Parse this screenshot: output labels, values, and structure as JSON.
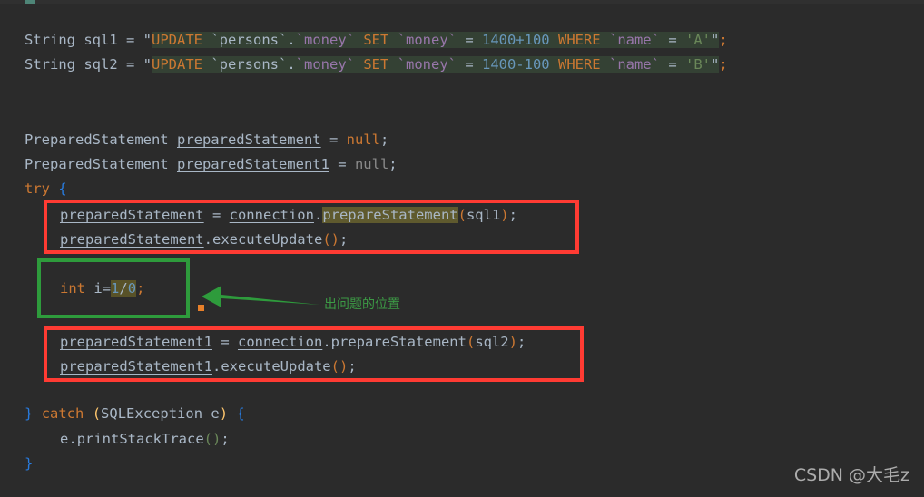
{
  "editor": {
    "theme_background": "#2b2b2b",
    "default_text_color": "#a9b7c6",
    "string_highlight_background": "#344134",
    "search_highlight_background": "#5f5a2e"
  },
  "code": {
    "lines": [
      {
        "id": "sql1",
        "parts": [
          {
            "text": "String ",
            "cls": "t-type"
          },
          {
            "text": "sql1",
            "cls": "t-var"
          },
          {
            "text": " = ",
            "cls": "t-op"
          },
          {
            "text": "\"",
            "cls": "t-quote"
          },
          {
            "text": "UPDATE ",
            "cls": "t-sqlkw sqlbg"
          },
          {
            "text": "`persons`",
            "cls": "t-sqlid sqlbg"
          },
          {
            "text": ".",
            "cls": "t-punc sqlbg"
          },
          {
            "text": "`money` ",
            "cls": "t-sqlcol sqlbg"
          },
          {
            "text": "SET ",
            "cls": "t-sqlkw sqlbg"
          },
          {
            "text": "`money`",
            "cls": "t-sqlcol sqlbg"
          },
          {
            "text": " = ",
            "cls": "t-op sqlbg"
          },
          {
            "text": "1400+100 ",
            "cls": "t-num sqlbg"
          },
          {
            "text": "WHERE ",
            "cls": "t-sqlkw sqlbg"
          },
          {
            "text": "`name`",
            "cls": "t-sqlcol sqlbg"
          },
          {
            "text": " = ",
            "cls": "t-op sqlbg"
          },
          {
            "text": "'A'",
            "cls": "t-str sqlbg"
          },
          {
            "text": "\"",
            "cls": "t-quote sqlbg"
          },
          {
            "text": ";",
            "cls": "t-kw"
          }
        ]
      },
      {
        "id": "sql2",
        "parts": [
          {
            "text": "String ",
            "cls": "t-type"
          },
          {
            "text": "sql2",
            "cls": "t-var"
          },
          {
            "text": " = ",
            "cls": "t-op"
          },
          {
            "text": "\"",
            "cls": "t-quote"
          },
          {
            "text": "UPDATE ",
            "cls": "t-sqlkw sqlbg"
          },
          {
            "text": "`persons`",
            "cls": "t-sqlid sqlbg"
          },
          {
            "text": ".",
            "cls": "t-punc sqlbg"
          },
          {
            "text": "`money` ",
            "cls": "t-sqlcol sqlbg"
          },
          {
            "text": "SET ",
            "cls": "t-sqlkw sqlbg"
          },
          {
            "text": "`money`",
            "cls": "t-sqlcol sqlbg"
          },
          {
            "text": " = ",
            "cls": "t-op sqlbg"
          },
          {
            "text": "1400-100 ",
            "cls": "t-num sqlbg"
          },
          {
            "text": "WHERE ",
            "cls": "t-sqlkw sqlbg"
          },
          {
            "text": "`name`",
            "cls": "t-sqlcol sqlbg"
          },
          {
            "text": " = ",
            "cls": "t-op sqlbg"
          },
          {
            "text": "'B'",
            "cls": "t-str sqlbg"
          },
          {
            "text": "\"",
            "cls": "t-quote sqlbg"
          },
          {
            "text": ";",
            "cls": "t-kw"
          }
        ]
      },
      {
        "id": "decl-ps",
        "parts": [
          {
            "text": "PreparedStatement ",
            "cls": "t-type"
          },
          {
            "text": "preparedStatement",
            "cls": "t-var u"
          },
          {
            "text": " = ",
            "cls": "t-op"
          },
          {
            "text": "null",
            "cls": "t-kw"
          },
          {
            "text": ";",
            "cls": "t-punc"
          }
        ]
      },
      {
        "id": "decl-ps1",
        "parts": [
          {
            "text": "PreparedStatement ",
            "cls": "t-type"
          },
          {
            "text": "preparedStatement1",
            "cls": "t-var u"
          },
          {
            "text": " = ",
            "cls": "t-op"
          },
          {
            "text": "null",
            "cls": "t-null"
          },
          {
            "text": ";",
            "cls": "t-punc"
          }
        ]
      },
      {
        "id": "try",
        "parts": [
          {
            "text": "try",
            "cls": "t-kw"
          },
          {
            "text": " ",
            "cls": "t-op"
          },
          {
            "text": "{",
            "cls": "t-brace"
          }
        ]
      },
      {
        "id": "assign-ps",
        "parts": [
          {
            "text": "preparedStatement",
            "cls": "t-var u"
          },
          {
            "text": " = ",
            "cls": "t-op"
          },
          {
            "text": "connection",
            "cls": "t-var u"
          },
          {
            "text": ".",
            "cls": "t-punc"
          },
          {
            "text": "prepareStatement",
            "cls": "t-method hl-olive"
          },
          {
            "text": "(",
            "cls": "t-paren"
          },
          {
            "text": "sql1",
            "cls": "t-var"
          },
          {
            "text": ")",
            "cls": "t-paren"
          },
          {
            "text": ";",
            "cls": "t-punc"
          }
        ]
      },
      {
        "id": "exec-ps",
        "parts": [
          {
            "text": "preparedStatement",
            "cls": "t-var u"
          },
          {
            "text": ".",
            "cls": "t-punc"
          },
          {
            "text": "executeUpdate",
            "cls": "t-method"
          },
          {
            "text": "()",
            "cls": "t-paren"
          },
          {
            "text": ";",
            "cls": "t-punc"
          }
        ]
      },
      {
        "id": "div-zero",
        "parts": [
          {
            "text": "int",
            "cls": "t-kw"
          },
          {
            "text": " ",
            "cls": "t-op"
          },
          {
            "text": "i",
            "cls": "t-var"
          },
          {
            "text": "=",
            "cls": "t-op"
          },
          {
            "text": "1",
            "cls": "t-num hl-olive2"
          },
          {
            "text": "/",
            "cls": "t-op hl-olive2"
          },
          {
            "text": "0",
            "cls": "t-num hl-olive2"
          },
          {
            "text": ";",
            "cls": "t-kw"
          }
        ]
      },
      {
        "id": "assign-ps1",
        "parts": [
          {
            "text": "preparedStatement1",
            "cls": "t-var u"
          },
          {
            "text": " = ",
            "cls": "t-op"
          },
          {
            "text": "connection",
            "cls": "t-var u"
          },
          {
            "text": ".",
            "cls": "t-punc"
          },
          {
            "text": "prepareStatement",
            "cls": "t-method"
          },
          {
            "text": "(",
            "cls": "t-paren"
          },
          {
            "text": "sql2",
            "cls": "t-var"
          },
          {
            "text": ")",
            "cls": "t-paren"
          },
          {
            "text": ";",
            "cls": "t-punc"
          }
        ]
      },
      {
        "id": "exec-ps1",
        "parts": [
          {
            "text": "preparedStatement1",
            "cls": "t-var u"
          },
          {
            "text": ".",
            "cls": "t-punc"
          },
          {
            "text": "executeUpdate",
            "cls": "t-method"
          },
          {
            "text": "()",
            "cls": "t-paren"
          },
          {
            "text": ";",
            "cls": "t-punc"
          }
        ]
      },
      {
        "id": "catch",
        "parts": [
          {
            "text": "}",
            "cls": "t-brace"
          },
          {
            "text": " ",
            "cls": "t-op"
          },
          {
            "text": "catch",
            "cls": "t-kw"
          },
          {
            "text": " ",
            "cls": "t-op"
          },
          {
            "text": "(",
            "cls": "t-class"
          },
          {
            "text": "SQLException",
            "cls": "t-type"
          },
          {
            "text": " e",
            "cls": "t-var"
          },
          {
            "text": ")",
            "cls": "t-class"
          },
          {
            "text": " ",
            "cls": "t-op"
          },
          {
            "text": "{",
            "cls": "t-brace"
          }
        ]
      },
      {
        "id": "printstack",
        "parts": [
          {
            "text": "e",
            "cls": "t-var"
          },
          {
            "text": ".",
            "cls": "t-punc"
          },
          {
            "text": "printStackTrace",
            "cls": "t-method"
          },
          {
            "text": "()",
            "cls": "t-parenG"
          },
          {
            "text": ";",
            "cls": "t-punc"
          }
        ]
      },
      {
        "id": "close-brace",
        "parts": [
          {
            "text": "}",
            "cls": "t-brace"
          }
        ]
      }
    ]
  },
  "annotations": {
    "red_box_color": "#ff3b33",
    "green_box_color": "#2e9b3c",
    "arrow_color": "#2e9b3c",
    "dot_color": "#e8802a",
    "note_text": "出问题的位置",
    "note_color": "#3c9a45"
  },
  "watermark": {
    "text": "CSDN @大毛z"
  }
}
